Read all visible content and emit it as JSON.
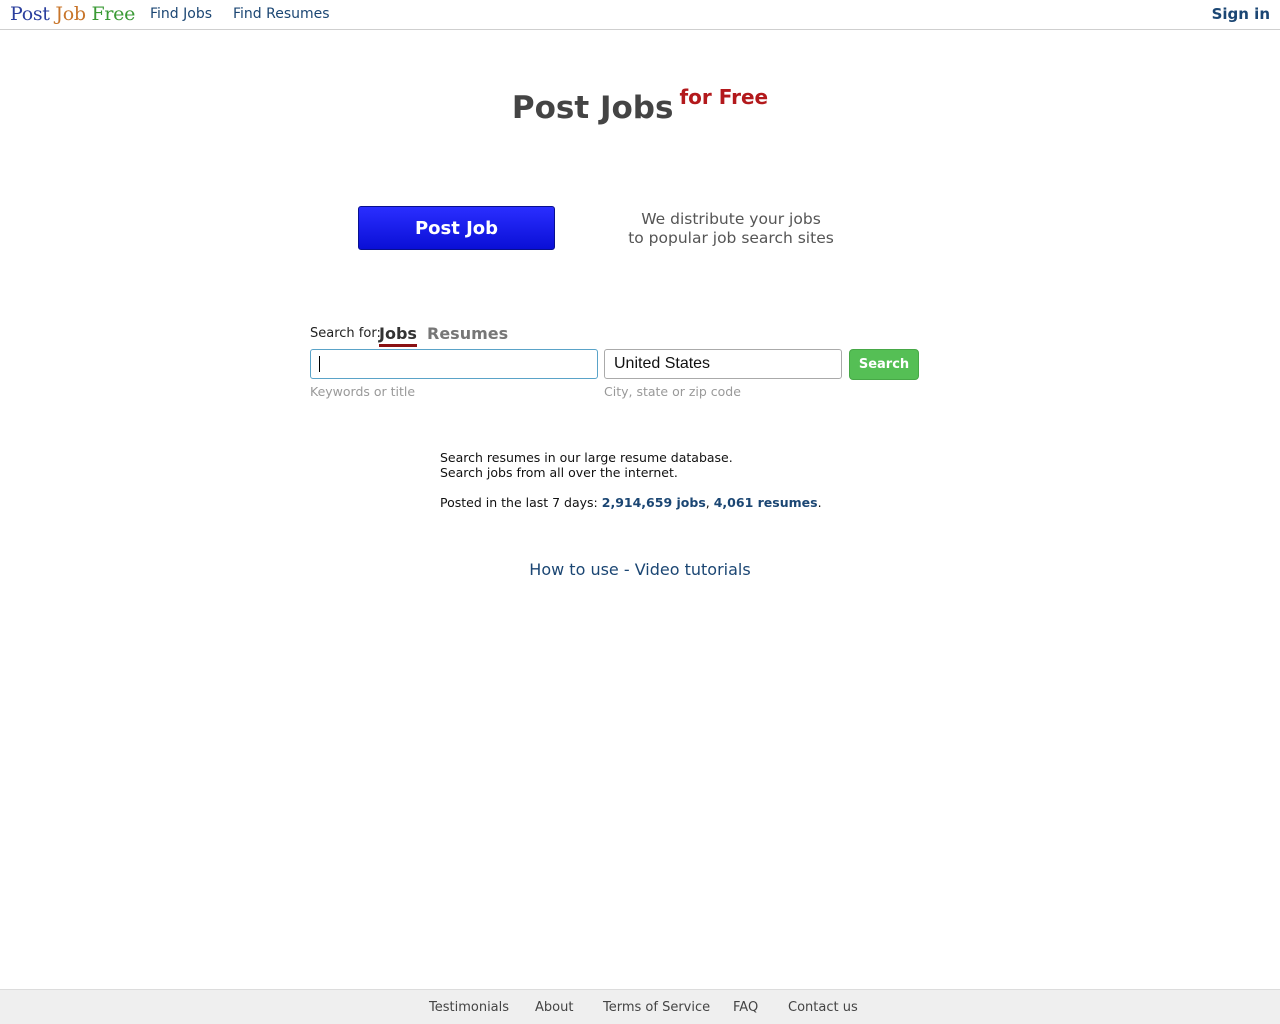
{
  "header": {
    "logo": {
      "word1": "Post",
      "word2": "Job",
      "word3": "Free"
    },
    "nav": {
      "find_jobs": "Find Jobs",
      "find_resumes": "Find Resumes"
    },
    "sign_in": "Sign in"
  },
  "hero": {
    "title": "Post Jobs",
    "title_sup": "for Free"
  },
  "post_button": "Post Job",
  "distribute": {
    "line1": "We distribute your jobs",
    "line2": "to popular job search sites"
  },
  "search": {
    "label": "Search for:",
    "tab_jobs": "Jobs",
    "tab_resumes": "Resumes",
    "keywords_value": "",
    "location_value": "United States",
    "button": "Search",
    "hint_keywords": "Keywords or title",
    "hint_location": "City, state or zip code"
  },
  "info": {
    "line1": "Search resumes in our large resume database.",
    "line2": "Search jobs from all over the internet.",
    "posted_prefix": "Posted in the last 7 days:",
    "jobs_count": "2,914,659 jobs",
    "sep": ",",
    "resumes_count": "4,061 resumes",
    "end": "."
  },
  "howto": "How to use - Video tutorials",
  "footer": {
    "testimonials": "Testimonials",
    "about": "About",
    "terms": "Terms of Service",
    "faq": "FAQ",
    "contact": "Contact us"
  },
  "colors": {
    "link": "#1b4673",
    "post_button": "#1a1ef0",
    "search_button": "#55bf55",
    "accent_red": "#b3191c"
  }
}
